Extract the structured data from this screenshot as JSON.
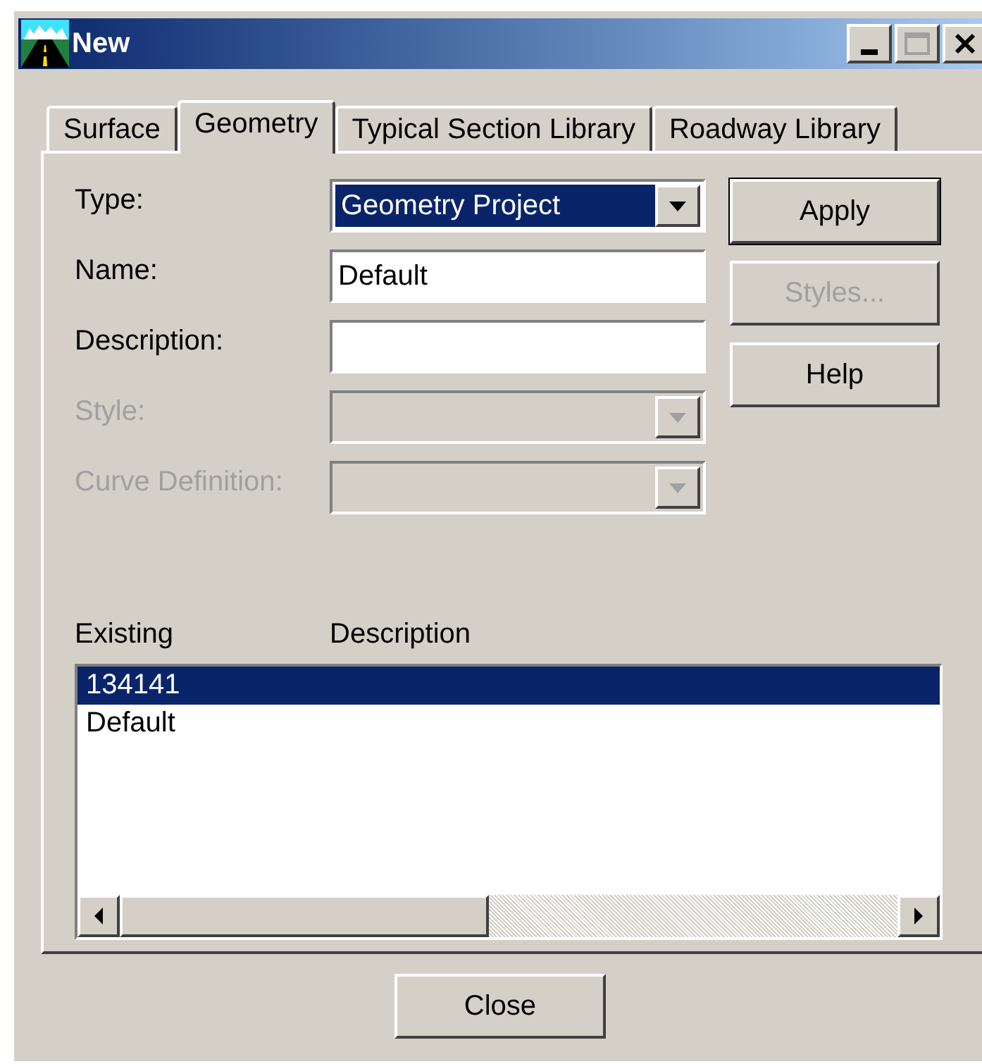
{
  "window": {
    "title": "New"
  },
  "tabs": [
    {
      "label": "Surface",
      "selected": false
    },
    {
      "label": "Geometry",
      "selected": true
    },
    {
      "label": "Typical Section Library",
      "selected": false
    },
    {
      "label": "Roadway Library",
      "selected": false
    }
  ],
  "fields": [
    {
      "label": "Type:",
      "kind": "dropdown",
      "value": "Geometry Project",
      "disabled": false,
      "highlighted": true
    },
    {
      "label": "Name:",
      "kind": "text",
      "value": "Default",
      "disabled": false
    },
    {
      "label": "Description:",
      "kind": "text",
      "disabled": false
    },
    {
      "label": "Style:",
      "kind": "dropdown",
      "disabled": true
    },
    {
      "label": "Curve Definition:",
      "kind": "dropdown",
      "disabled": true
    }
  ],
  "side_buttons": [
    {
      "label": "Apply",
      "disabled": false,
      "default": true
    },
    {
      "label": "Styles...",
      "disabled": true,
      "default": false
    },
    {
      "label": "Help",
      "disabled": false,
      "default": false
    }
  ],
  "list": {
    "columns": [
      "Existing",
      "Description"
    ],
    "rows": [
      {
        "name": "134141",
        "selected": true
      },
      {
        "name": "Default",
        "selected": false
      }
    ]
  },
  "close_button": "Close"
}
